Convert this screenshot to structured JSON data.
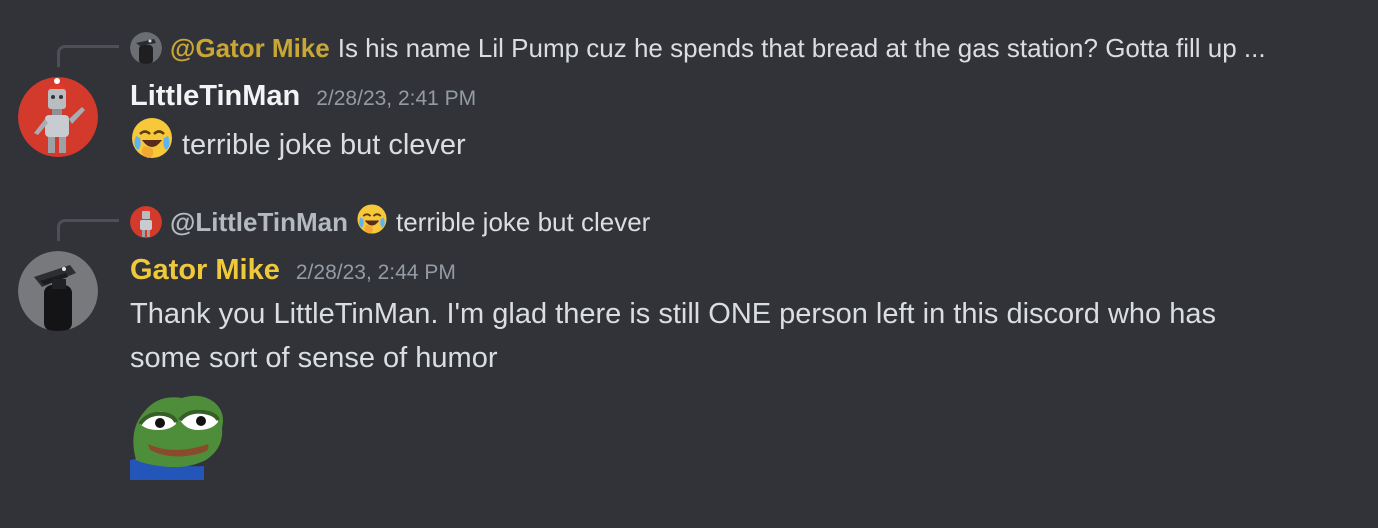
{
  "messages": [
    {
      "reply": {
        "mention": "@Gator Mike",
        "text": "Is his name Lil Pump cuz he spends that bread at the gas station? Gotta fill up ..."
      },
      "author": "LittleTinMan",
      "timestamp": "2/28/23, 2:41 PM",
      "lines": [
        "terrible joke but clever"
      ],
      "emoji": "face-holding-back-tears-laughing",
      "author_color": "#f2f3f5"
    },
    {
      "reply": {
        "mention": "@LittleTinMan",
        "text": "terrible joke but clever"
      },
      "author": "Gator Mike",
      "timestamp": "2/28/23, 2:44 PM",
      "lines": [
        "Thank you LittleTinMan. I'm glad there is still ONE person left in this discord who has",
        "some sort of sense of humor"
      ],
      "sticker": "pepe-frog-sticker",
      "author_color": "#f0c93a"
    }
  ],
  "colors": {
    "background": "#313338",
    "text": "#dbdee1",
    "muted": "#949ba4",
    "reply_mention_gator": "#c9a735"
  }
}
